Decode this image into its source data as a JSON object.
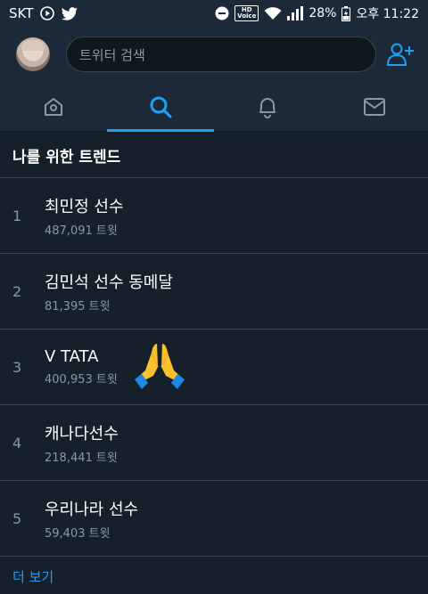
{
  "status_bar": {
    "carrier": "SKT",
    "battery": "28%",
    "time": "오후 11:22",
    "hd_label": "HD",
    "voice_label": "Voice"
  },
  "header": {
    "search_placeholder": "트위터 검색"
  },
  "trends": {
    "title": "나를 위한 트렌드",
    "items": [
      {
        "rank": "1",
        "name": "최민정 선수",
        "count": "487,091 트윗"
      },
      {
        "rank": "2",
        "name": "김민석 선수 동메달",
        "count": "81,395 트윗"
      },
      {
        "rank": "3",
        "name": "V TATA",
        "count": "400,953 트윗"
      },
      {
        "rank": "4",
        "name": "캐나다선수",
        "count": "218,441 트윗"
      },
      {
        "rank": "5",
        "name": "우리나라 선수",
        "count": "59,403 트윗"
      }
    ],
    "more_label": "더 보기"
  },
  "colors": {
    "accent": "#1da1f2",
    "background": "#15202b",
    "panel": "#1c2938",
    "muted": "#8899a6"
  }
}
